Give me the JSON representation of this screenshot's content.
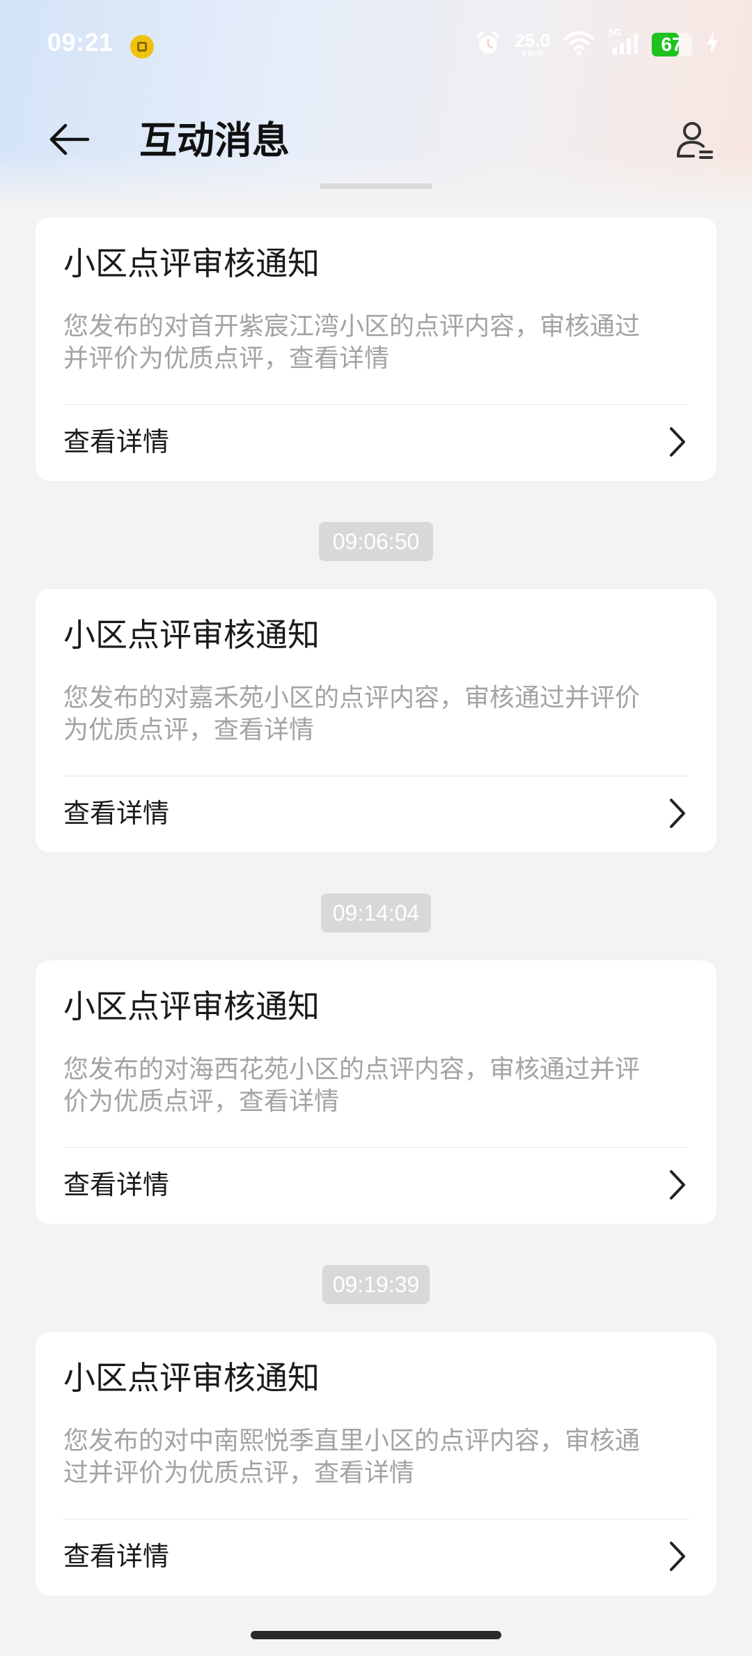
{
  "status_bar": {
    "time": "09:21",
    "net_speed_value": "25.0",
    "net_speed_unit": "KB/S",
    "signal_label": "5G",
    "battery_percent": 67,
    "battery_text": "67",
    "icons": [
      "notification-app-icon",
      "alarm-icon",
      "wifi-icon",
      "signal-icon",
      "battery-icon",
      "charging-icon"
    ]
  },
  "app_bar": {
    "title": "互动消息",
    "back_icon": "back-arrow-icon",
    "profile_icon": "user-settings-icon"
  },
  "messages": [
    {
      "time": "",
      "title": "小区点评审核通知",
      "desc_line1": "您发布的对首开紫宸江湾小区的点评内容，审核通过",
      "desc_line2": "并评价为优质点评，查看详情",
      "action": "查看详情"
    },
    {
      "time": "09:06:50",
      "title": "小区点评审核通知",
      "desc_line1": "您发布的对嘉禾苑小区的点评内容，审核通过并评价",
      "desc_line2": "为优质点评，查看详情",
      "action": "查看详情"
    },
    {
      "time": "09:14:04",
      "title": "小区点评审核通知",
      "desc_line1": "您发布的对海西花苑小区的点评内容，审核通过并评",
      "desc_line2": "价为优质点评，查看详情",
      "action": "查看详情"
    },
    {
      "time": "09:19:39",
      "title": "小区点评审核通知",
      "desc_line1": "您发布的对中南熙悦季直里小区的点评内容，审核通",
      "desc_line2": "过并评价为优质点评，查看详情",
      "action": "查看详情"
    }
  ],
  "colors": {
    "background": "#f3f3f3",
    "card": "#ffffff",
    "title_text": "#1a1a1a",
    "desc_text": "#a3a3a3",
    "time_pill": "#d8d8d8",
    "battery_green": "#1ec21e"
  }
}
